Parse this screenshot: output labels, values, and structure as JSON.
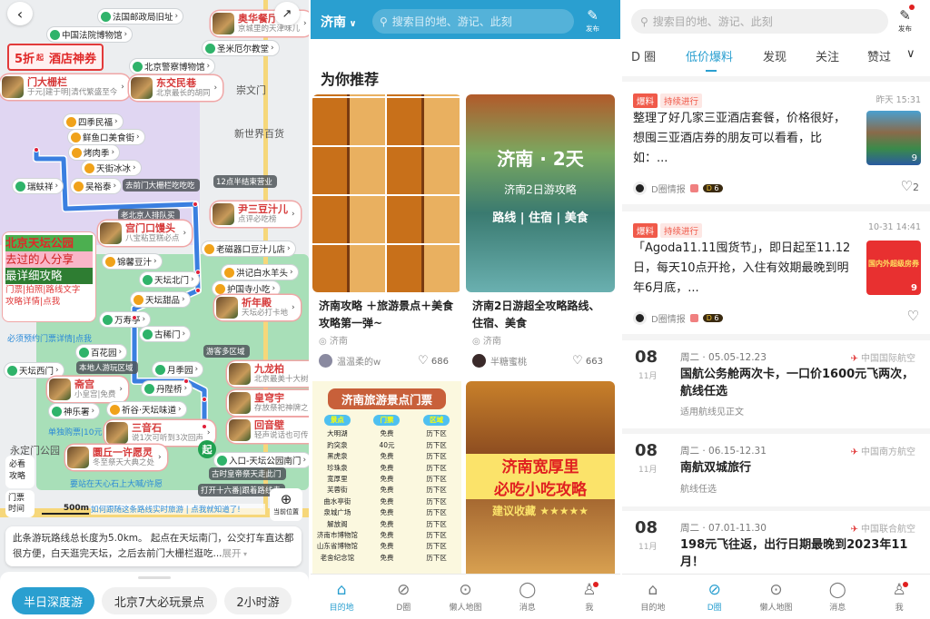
{
  "map": {
    "promo": {
      "discount": "5折",
      "suffix": "起",
      "label": "酒店神券"
    },
    "pois": [
      {
        "text": "法国邮政局旧址",
        "kind": "sight"
      },
      {
        "text": "中国法院博物馆",
        "kind": "sight"
      },
      {
        "text": "奥华餐厅",
        "sub": "京城里的天津味儿",
        "kind": "feat"
      },
      {
        "text": "圣米厄尔教堂",
        "kind": "sight"
      },
      {
        "text": "北京警察博物馆",
        "kind": "sight"
      },
      {
        "text": "门大栅栏",
        "sub": "于元|建于明|清代繁盛至今",
        "kind": "feat"
      },
      {
        "text": "东交民巷",
        "sub": "北京最长的胡同",
        "kind": "feat"
      },
      {
        "text": "崇文门",
        "kind": "plain"
      },
      {
        "text": "新世界百货",
        "kind": "plain"
      },
      {
        "text": "四季民福",
        "kind": "food"
      },
      {
        "text": "鲜鱼口美食街",
        "kind": "food"
      },
      {
        "text": "烤肉季",
        "kind": "food"
      },
      {
        "text": "天街冰冰",
        "kind": "food"
      },
      {
        "text": "瑞蚨祥",
        "kind": "sight"
      },
      {
        "text": "吴裕泰",
        "kind": "food"
      },
      {
        "text": "去前门大栅栏吃吃吃",
        "kind": "note"
      },
      {
        "text": "12点半结束营业",
        "kind": "note"
      },
      {
        "text": "老北京人排队买",
        "kind": "note"
      },
      {
        "text": "尹三豆汁儿",
        "sub": "点评必吃榜",
        "kind": "feat"
      },
      {
        "text": "宫门口馒头",
        "sub": "八宝粘豆糕必点",
        "kind": "feat"
      },
      {
        "text": "老磁器口豆汁儿店",
        "kind": "food"
      },
      {
        "text": "锦馨豆汁",
        "kind": "food"
      },
      {
        "text": "洪记白水羊头",
        "kind": "food"
      },
      {
        "text": "天坛北门",
        "kind": "sight"
      },
      {
        "text": "护国寺小吃",
        "kind": "food"
      },
      {
        "text": "天坛甜品",
        "kind": "food"
      },
      {
        "text": "祈年殿",
        "sub": "天坛必打卡地",
        "kind": "feat"
      },
      {
        "text": "万寿亭",
        "kind": "sight"
      },
      {
        "text": "古稀门",
        "kind": "sight"
      },
      {
        "text": "必须预约门票详情|点我",
        "kind": "link"
      },
      {
        "text": "百花园",
        "kind": "sight"
      },
      {
        "text": "本地人游玩区域",
        "kind": "note"
      },
      {
        "text": "游客多区域",
        "kind": "note"
      },
      {
        "text": "天坛西门",
        "kind": "sight"
      },
      {
        "text": "月季园",
        "kind": "sight"
      },
      {
        "text": "九龙柏",
        "sub": "北京最美十大树",
        "kind": "feat"
      },
      {
        "text": "斋宫",
        "sub": "小皇宫|免费",
        "kind": "feat"
      },
      {
        "text": "丹陛桥",
        "kind": "sight"
      },
      {
        "text": "皇穹宇",
        "sub": "存放祭祀神牌之",
        "kind": "feat"
      },
      {
        "text": "神乐署",
        "kind": "sight"
      },
      {
        "text": "祈谷·天坛味道",
        "kind": "food"
      },
      {
        "text": "单独购票|10元",
        "kind": "link"
      },
      {
        "text": "三音石",
        "sub": "说1次可听到3次回声",
        "kind": "feat"
      },
      {
        "text": "回音壁",
        "sub": "轻声说话也可传",
        "kind": "feat"
      },
      {
        "text": "永定门公园",
        "kind": "plain"
      },
      {
        "text": "圜丘一许愿灵",
        "sub": "冬至祭天大典之处",
        "kind": "feat"
      },
      {
        "text": "入口-天坛公园南门",
        "kind": "sight"
      },
      {
        "text": "古时皇帝祭天走此门",
        "kind": "note"
      },
      {
        "text": "打开十六番|跟着路线走",
        "kind": "note"
      },
      {
        "text": "要站在天心石上大喊/许愿",
        "kind": "link"
      }
    ],
    "guide_card": {
      "line1": "北京天坛公园",
      "line2": "去过的人分享",
      "line3": "最详细攻略",
      "link1": "门票|拍照|路线文字",
      "link2": "攻略详情|点我"
    },
    "start_marker": "起",
    "side_buttons": [
      "必看攻略",
      "门票时间"
    ],
    "scale": "500m",
    "follow_banner": "如何跟随这条路线实时旅游 | 点我就知道了!",
    "locate_label": "当前位置",
    "description": "此条游玩路线总长度为5.0km。 起点在天坛南门，公交打车直达都很方便，白天逛完天坛，之后去前门大栅栏逛吃...",
    "expand": "展开",
    "chips": [
      "半日深度游",
      "北京7大必玩景点",
      "2小时游"
    ],
    "colors": {
      "route": "#3a7fe0",
      "park": "#8fd6a8",
      "active_chip": "#2a9fd0"
    }
  },
  "mid": {
    "city": "济南",
    "search_placeholder": "搜索目的地、游记、此刻",
    "publish": "发布",
    "section_title": "为你推荐",
    "cards": [
      {
        "title": "济南攻略 ＋旅游景点＋美食攻略第一弹~",
        "location": "济南",
        "author": "温温柔的w",
        "likes": "686"
      },
      {
        "title": "济南2日游超全攻略路线、住宿、美食",
        "location": "济南",
        "author": "半糖蜜桃",
        "likes": "663",
        "image_text": {
          "title": "济南 · 2天",
          "sub": "济南2日游攻略",
          "tags": "路线 | 住宿 | 美食"
        }
      },
      {
        "image_text": {
          "title": "济南旅游景点门票",
          "headers": [
            "景点",
            "门票",
            "区域"
          ],
          "rows": [
            [
              "大明湖",
              "免费",
              "历下区"
            ],
            [
              "趵突泉",
              "40元",
              "历下区"
            ],
            [
              "黑虎泉",
              "免费",
              "历下区"
            ],
            [
              "珍珠泉",
              "免费",
              "历下区"
            ],
            [
              "宽厚里",
              "免费",
              "历下区"
            ],
            [
              "芙蓉街",
              "免费",
              "历下区"
            ],
            [
              "曲水亭街",
              "免费",
              "历下区"
            ],
            [
              "泉城广场",
              "免费",
              "历下区"
            ],
            [
              "解放阁",
              "免费",
              "历下区"
            ],
            [
              "济南市博物馆",
              "免费",
              "历下区"
            ],
            [
              "山东省博物馆",
              "免费",
              "历下区"
            ],
            [
              "老舍纪念馆",
              "免费",
              "历下区"
            ]
          ]
        }
      },
      {
        "image_text": {
          "line1": "济南宽厚里",
          "line2": "必吃小吃攻略",
          "badge": "建议收藏"
        }
      }
    ],
    "nav": [
      "目的地",
      "D圈",
      "懒人地图",
      "消息",
      "我"
    ],
    "colors": {
      "header": "#2a9fd0"
    }
  },
  "right": {
    "search_placeholder": "搜索目的地、游记、此刻",
    "publish": "发布",
    "tabs": [
      "D 圈",
      "低价爆料",
      "发现",
      "关注",
      "赞过"
    ],
    "active_tab": "低价爆料",
    "posts": [
      {
        "tag1": "爆料",
        "tag2": "持续进行",
        "time": "昨天 15:31",
        "text": "整理了好几家三亚酒店套餐，价格很好，想囤三亚酒店券的朋友可以看看，比如：...",
        "author": "D圈情报",
        "level": "6",
        "likes": "2",
        "img_count": "9"
      },
      {
        "tag1": "爆料",
        "tag2": "持续进行",
        "time": "10-31 14:41",
        "text": "「Agoda11.11囤货节」，即日起至11.12日，每天10点开抢，入住有效期最晚到明年6月底，...",
        "author": "D圈情报",
        "level": "6",
        "likes": "",
        "img_count": "9",
        "img_text": "国内外超级房券"
      }
    ],
    "deals": [
      {
        "day": "08",
        "month": "11月",
        "date": "周二 · 05.05-12.23",
        "airline": "中国国际航空",
        "title": "国航公务舱两次卡，一口价1600元飞两次，航线任选",
        "sub": "适用航线见正文"
      },
      {
        "day": "08",
        "month": "11月",
        "date": "周二 · 06.15-12.31",
        "airline": "中国南方航空",
        "title": "南航双城旅行",
        "sub": "航线任选"
      },
      {
        "day": "08",
        "month": "11月",
        "date": "周二 · 07.01-11.30",
        "airline": "中国联合航空",
        "title": "198元飞往返，出行日期最晚到2023年11月！",
        "sub": ""
      }
    ],
    "nav": [
      "目的地",
      "D圈",
      "懒人地图",
      "消息",
      "我"
    ],
    "colors": {
      "tag": "#f05a4a",
      "accent": "#2a9fd0"
    }
  }
}
